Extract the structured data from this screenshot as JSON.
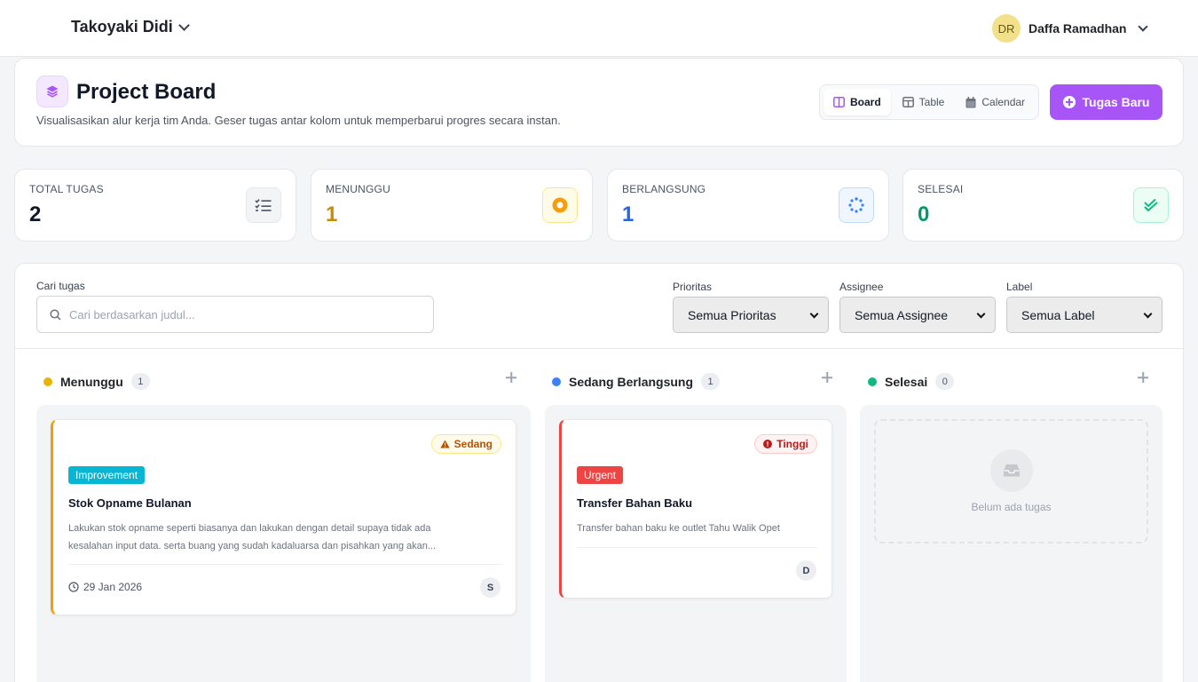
{
  "topbar": {
    "store_name": "Takoyaki Didi",
    "user_initials": "DR",
    "user_name": "Daffa Ramadhan"
  },
  "header": {
    "title": "Project Board",
    "subtitle": "Visualisasikan alur kerja tim Anda. Geser tugas antar kolom untuk memperbarui progres secara instan.",
    "views": [
      {
        "label": "Board",
        "active": true
      },
      {
        "label": "Table"
      },
      {
        "label": "Calendar"
      }
    ],
    "new_task_label": "Tugas Baru"
  },
  "colors": {
    "accent": "#a855f7",
    "waiting": "#eab308",
    "in_progress": "#3b82f6",
    "done": "#10b981",
    "urgent": "#ef4444",
    "improvement": "#06b6d4"
  },
  "stats": [
    {
      "label": "TOTAL TUGAS",
      "value": "2",
      "icon": "list-check-icon"
    },
    {
      "label": "MENUNGGU",
      "value": "1",
      "icon": "record-circle-icon"
    },
    {
      "label": "BERLANGSUNG",
      "value": "1",
      "icon": "spinner-icon"
    },
    {
      "label": "SELESAI",
      "value": "0",
      "icon": "check-double-icon"
    }
  ],
  "filters": {
    "search_label": "Cari tugas",
    "search_placeholder": "Cari berdasarkan judul...",
    "priority": {
      "label": "Prioritas",
      "value": "Semua Prioritas"
    },
    "assignee": {
      "label": "Assignee",
      "value": "Semua Assignee"
    },
    "tag": {
      "label": "Label",
      "value": "Semua Label"
    }
  },
  "columns": [
    {
      "name": "Menunggu",
      "count": "1",
      "task": {
        "priority": "Sedang",
        "tag": "Improvement",
        "title": "Stok Opname Bulanan",
        "desc1": "Lakukan stok opname seperti biasanya dan lakukan dengan detail supaya tidak ada",
        "desc2": "kesalahan input data. serta buang yang sudah kadaluarsa dan pisahkan yang akan...",
        "date": "29 Jan 2026",
        "assignee": "S"
      }
    },
    {
      "name": "Sedang Berlangsung",
      "count": "1",
      "task": {
        "priority": "Tinggi",
        "tag": "Urgent",
        "title": "Transfer Bahan Baku",
        "desc1": "Transfer bahan baku ke outlet Tahu Walik Opet",
        "assignee": "D"
      }
    },
    {
      "name": "Selesai",
      "count": "0",
      "empty_text": "Belum ada tugas"
    }
  ]
}
